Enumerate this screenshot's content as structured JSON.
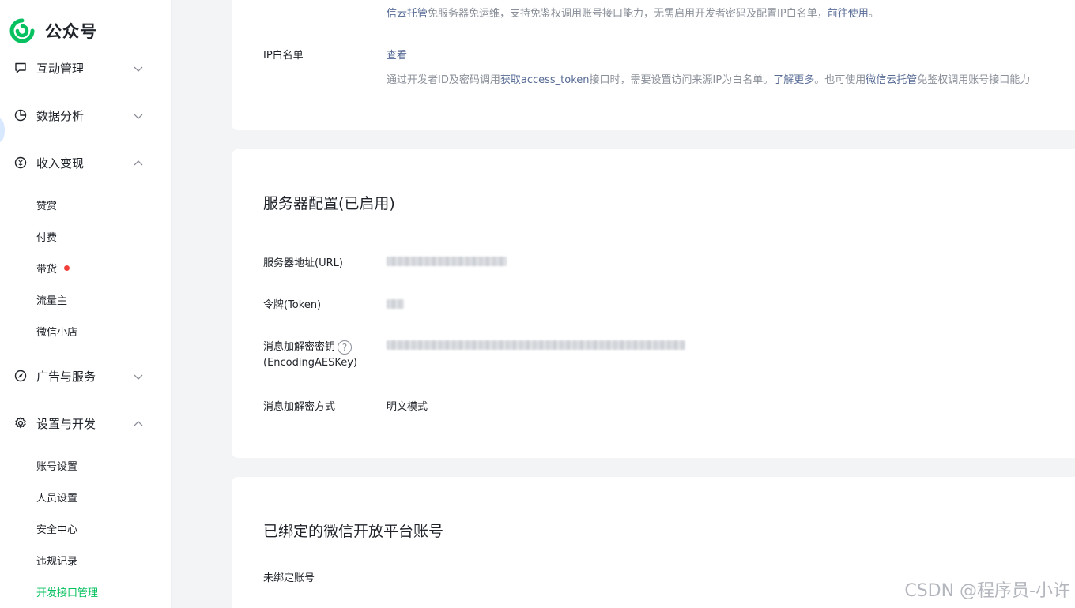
{
  "app": {
    "name": "公众号",
    "brand_color": "#07c160",
    "link_color": "#576b95"
  },
  "sidebar": {
    "groups": [
      {
        "label": "互动管理",
        "icon": "comment-icon",
        "expanded": false
      },
      {
        "label": "数据分析",
        "icon": "pie-chart-icon",
        "expanded": false
      },
      {
        "label": "收入变现",
        "icon": "yen-icon",
        "expanded": true,
        "items": [
          "赞赏",
          "付费",
          "带货",
          "流量主",
          "微信小店"
        ]
      },
      {
        "label": "广告与服务",
        "icon": "compass-icon",
        "expanded": false
      },
      {
        "label": "设置与开发",
        "icon": "gear-icon",
        "expanded": true,
        "items": [
          "账号设置",
          "人员设置",
          "安全中心",
          "违规记录",
          "开发接口管理"
        ]
      }
    ],
    "active_item": "开发接口管理"
  },
  "top_card": {
    "cloud_line": {
      "link1": "信云托管",
      "text1": "免服务器免运维，支持免鉴权调用账号接口能力，无需启用开发者密码及配置IP白名单，",
      "link2": "前往使用",
      "end": "。"
    },
    "ip_whitelist": {
      "label": "IP白名单",
      "action": "查看",
      "desc": {
        "t1": "通过开发者ID及密码调用",
        "l1": "获取access_token",
        "t2": "接口时，需要设置访问来源IP为白名单。",
        "l2": "了解更多",
        "t3": "。也可使用",
        "l3": "微信云托管",
        "t4": "免鉴权调用账号接口能力"
      }
    }
  },
  "server_config": {
    "title": "服务器配置(已启用)",
    "rows": [
      {
        "label": "服务器地址(URL)"
      },
      {
        "label": "令牌(Token)"
      },
      {
        "label_line1": "消息加解密密钥",
        "label_line2": "(EncodingAESKey)",
        "help": "?"
      },
      {
        "label": "消息加解密方式",
        "value": "明文模式"
      }
    ]
  },
  "open_platform": {
    "title": "已绑定的微信开放平台账号",
    "status": "未绑定账号"
  },
  "watermark": "CSDN @程序员-小许"
}
